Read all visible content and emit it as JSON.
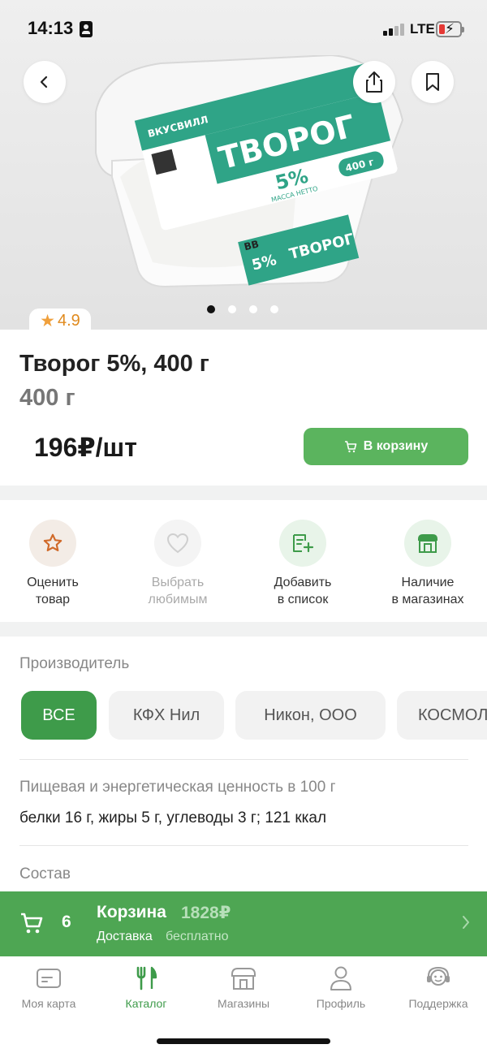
{
  "status": {
    "time": "14:13",
    "network": "LTE"
  },
  "product": {
    "rating": "4.9",
    "title": "Творог 5%, 400 г",
    "weight": "400 г",
    "price": "196₽/шт",
    "add_to_cart_label": "В корзину",
    "image_dots": 4,
    "image_active": 0,
    "package_labels": {
      "brand": "ВКУСВИЛЛ",
      "name": "ТВОРОГ",
      "fat": "5%",
      "mass": "400 г",
      "net": "МАССА НЕТТО",
      "bb": "ВВ"
    }
  },
  "actions": [
    {
      "label_1": "Оценить",
      "label_2": "товар",
      "icon": "star-icon",
      "enabled": true
    },
    {
      "label_1": "Выбрать",
      "label_2": "любимым",
      "icon": "heart-icon",
      "enabled": false
    },
    {
      "label_1": "Добавить",
      "label_2": "в список",
      "icon": "add-to-list-icon",
      "enabled": true
    },
    {
      "label_1": "Наличие",
      "label_2": "в магазинах",
      "icon": "store-icon",
      "enabled": true
    }
  ],
  "manufacturer": {
    "label": "Производитель",
    "chips": [
      "ВСЕ",
      "КФХ Нил",
      "Никон, ООО",
      "КОСМОЛ"
    ],
    "selected": "ВСЕ"
  },
  "nutrition": {
    "label": "Пищевая и энергетическая ценность в 100 г",
    "value": "белки 16 г, жиры 5 г, углеводы 3 г; 121 ккал"
  },
  "composition": {
    "label": "Состав"
  },
  "basket": {
    "count": "6",
    "title": "Корзина",
    "sum": "1828₽",
    "delivery_label": "Доставка",
    "delivery_value": "бесплатно"
  },
  "tabs": [
    {
      "label": "Моя карта",
      "icon": "card-icon",
      "active": false
    },
    {
      "label": "Каталог",
      "icon": "fork-knife-icon",
      "active": true
    },
    {
      "label": "Магазины",
      "icon": "store-icon",
      "active": false
    },
    {
      "label": "Профиль",
      "icon": "profile-icon",
      "active": false
    },
    {
      "label": "Поддержка",
      "icon": "support-icon",
      "active": false
    }
  ],
  "colors": {
    "brand_green": "#4ea653",
    "active_chip": "#3e9b4a",
    "rating": "#f0a03c",
    "package_teal": "#2fa487"
  }
}
